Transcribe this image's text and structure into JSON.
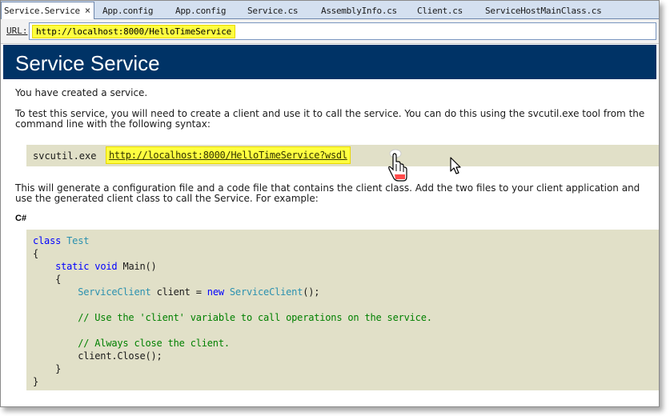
{
  "tabs": [
    {
      "label": "Service.Service",
      "active": true
    },
    {
      "label": "App.config"
    },
    {
      "label": "App.config"
    },
    {
      "label": "Service.cs"
    },
    {
      "label": "AssemblyInfo.cs"
    },
    {
      "label": "Client.cs"
    },
    {
      "label": "ServiceHostMainClass.cs"
    }
  ],
  "tab_close_glyph": "×",
  "url_bar": {
    "label": "URL:",
    "value": "http://localhost:8000/HelloTimeService"
  },
  "page": {
    "title": "Service Service",
    "created_text": "You have created a service.",
    "instructions_text": "To test this service, you will need to create a client and use it to call the service. You can do this using the svcutil.exe tool from the command line with the following syntax:",
    "svcutil_label": "svcutil.exe",
    "wsdl_link": "http://localhost:8000/HelloTimeService?wsdl",
    "generate_text": "This will generate a configuration file and a code file that contains the client class. Add the two files to your client application and use the generated client class to call the Service. For example:",
    "language_label": "C#",
    "code": {
      "kw_class": "class",
      "type_test": "Test",
      "open_brace": "{",
      "kw_static": "static",
      "kw_void": "void",
      "method_main": "Main()",
      "type_service_client": "ServiceClient",
      "var_client": "client =",
      "kw_new": "new",
      "call_ctor": "();",
      "comment_use": "// Use the 'client' variable to call operations on the service.",
      "comment_close": "// Always close the client.",
      "close_call": "client.Close();",
      "close_brace": "}"
    }
  },
  "icons": [
    "hand-pointer-icon",
    "arrow-cursor-icon"
  ],
  "colors": {
    "header_bg": "#003366",
    "code_bg": "#e1e0c8",
    "highlight": "#ffff40",
    "keyword": "#0000ff",
    "type": "#2b91af",
    "comment": "#008000"
  }
}
